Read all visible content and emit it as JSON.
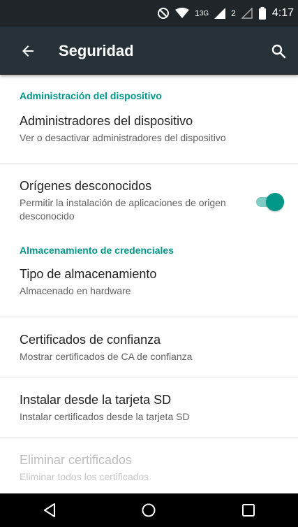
{
  "status_bar": {
    "network_type": "3G",
    "sim1_label": "1",
    "sim2_label": "2",
    "time": "4:17",
    "icons": [
      "do-not-disturb-icon",
      "wifi-icon",
      "signal-icon",
      "signal-empty-icon",
      "battery-icon"
    ]
  },
  "toolbar": {
    "title": "Seguridad",
    "back_icon": "arrow-back-icon",
    "search_icon": "search-icon"
  },
  "sections": [
    {
      "header": "Administración del dispositivo",
      "items": [
        {
          "title": "Administradores del dispositivo",
          "summary": "Ver o desactivar administradores del dispositivo"
        },
        {
          "title": "Orígenes desconocidos",
          "summary": "Permitir la instalación de aplicaciones de origen desconocido",
          "toggle_on": true
        }
      ]
    },
    {
      "header": "Almacenamiento de credenciales",
      "items": [
        {
          "title": "Tipo de almacenamiento",
          "summary": "Almacenado en hardware"
        },
        {
          "title": "Certificados de confianza",
          "summary": "Mostrar certificados de CA de confianza"
        },
        {
          "title": "Instalar desde la tarjeta SD",
          "summary": "Instalar certificados desde la tarjeta SD"
        },
        {
          "title": "Eliminar certificados",
          "summary": "Eliminar todos los certificados",
          "disabled": true
        }
      ]
    }
  ],
  "nav_bar": {
    "back_icon": "nav-back-icon",
    "home_icon": "nav-home-icon",
    "recents_icon": "nav-recents-icon"
  },
  "colors": {
    "accent": "#009688",
    "toolbar": "#263238",
    "status_bar": "#1f2528",
    "toggle_track": "#80cbc4"
  }
}
